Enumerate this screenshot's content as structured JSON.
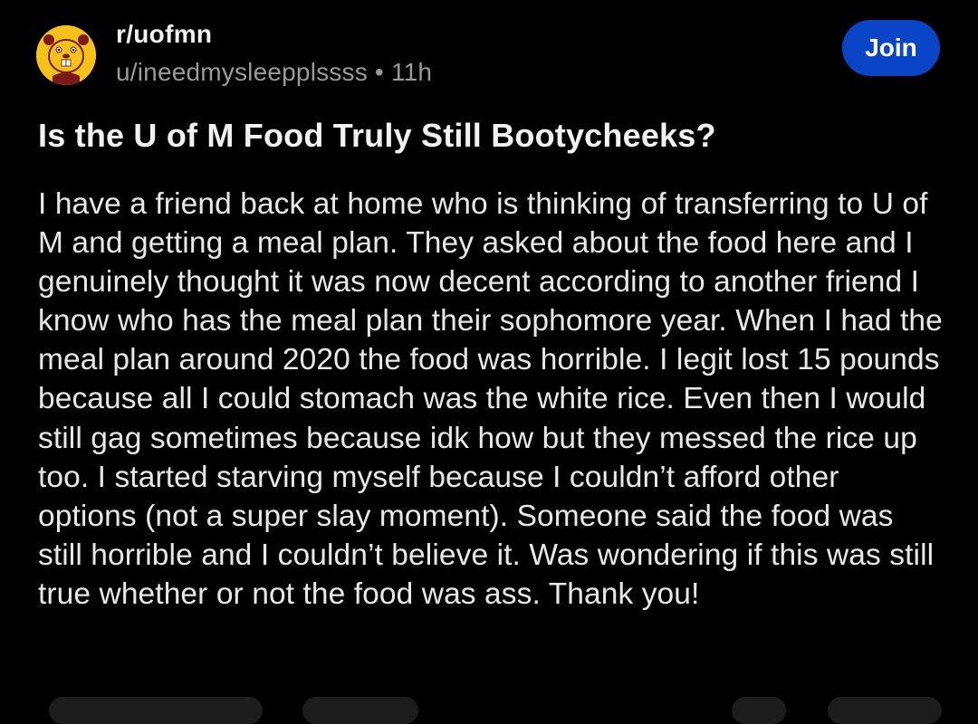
{
  "post": {
    "subreddit": "r/uofmn",
    "author": "u/ineedmysleepplssss",
    "separator": "•",
    "age": "11h",
    "join_label": "Join",
    "title": "Is the U of M Food Truly Still Bootycheeks?",
    "body": "I have a friend back at home who is thinking of transferring to U of M and getting a meal plan. They asked about the food here and I genuinely thought it was now decent according to another friend I know who has the meal plan their sophomore year. When I had the meal plan around 2020 the food was horrible. I legit lost 15 pounds because all I could stomach was the white rice. Even then I would still gag sometimes because idk how but they messed the rice up too. I started starving myself because I couldn’t afford other options (not a super slay moment). Someone said the food was still horrible and I couldn’t believe it. Was wondering if this was still true whether or not the food was ass. Thank you!"
  },
  "icons": {
    "avatar": "gopher-mascot-icon"
  },
  "colors": {
    "background": "#000000",
    "join_button": "#0a45c7",
    "avatar": "#f6c21a",
    "muted_text": "#9a9a9a"
  }
}
